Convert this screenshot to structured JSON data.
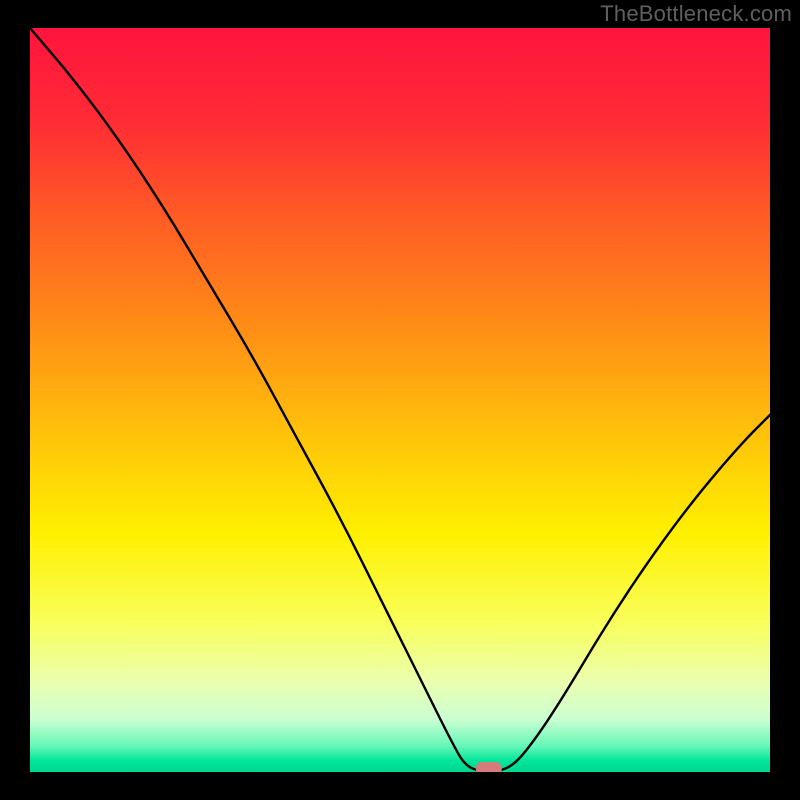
{
  "watermark": "TheBottleneck.com",
  "colors": {
    "frame": "#000000",
    "watermark": "#5f5f5f",
    "curve": "#000000",
    "marker": "#d47d7a",
    "gradient_stops": [
      {
        "offset": 0.0,
        "color": "#ff143e"
      },
      {
        "offset": 0.12,
        "color": "#ff2a35"
      },
      {
        "offset": 0.25,
        "color": "#ff5a25"
      },
      {
        "offset": 0.4,
        "color": "#ff8c16"
      },
      {
        "offset": 0.55,
        "color": "#ffc40a"
      },
      {
        "offset": 0.68,
        "color": "#fff000"
      },
      {
        "offset": 0.8,
        "color": "#f9ff5c"
      },
      {
        "offset": 0.88,
        "color": "#eaffb0"
      },
      {
        "offset": 0.93,
        "color": "#c9ffd2"
      },
      {
        "offset": 0.965,
        "color": "#66f7b8"
      },
      {
        "offset": 0.985,
        "color": "#00e69a"
      },
      {
        "offset": 1.0,
        "color": "#00d690"
      }
    ]
  },
  "chart_data": {
    "type": "line",
    "title": "",
    "xlabel": "",
    "ylabel": "",
    "xlim": [
      0,
      100
    ],
    "ylim": [
      0,
      100
    ],
    "grid": false,
    "legend": false,
    "marker": {
      "x": 62,
      "y": 0
    },
    "series": [
      {
        "name": "bottleneck-curve",
        "points": [
          {
            "x": 0,
            "y": 100
          },
          {
            "x": 6,
            "y": 93
          },
          {
            "x": 12,
            "y": 85
          },
          {
            "x": 18,
            "y": 76
          },
          {
            "x": 24,
            "y": 66
          },
          {
            "x": 30,
            "y": 56
          },
          {
            "x": 36,
            "y": 45
          },
          {
            "x": 42,
            "y": 34
          },
          {
            "x": 48,
            "y": 22
          },
          {
            "x": 53,
            "y": 12
          },
          {
            "x": 57,
            "y": 4
          },
          {
            "x": 59,
            "y": 0.5
          },
          {
            "x": 62,
            "y": 0
          },
          {
            "x": 65,
            "y": 0.5
          },
          {
            "x": 68,
            "y": 4
          },
          {
            "x": 72,
            "y": 10
          },
          {
            "x": 78,
            "y": 20
          },
          {
            "x": 84,
            "y": 29
          },
          {
            "x": 90,
            "y": 37
          },
          {
            "x": 96,
            "y": 44
          },
          {
            "x": 100,
            "y": 48
          }
        ]
      }
    ]
  }
}
